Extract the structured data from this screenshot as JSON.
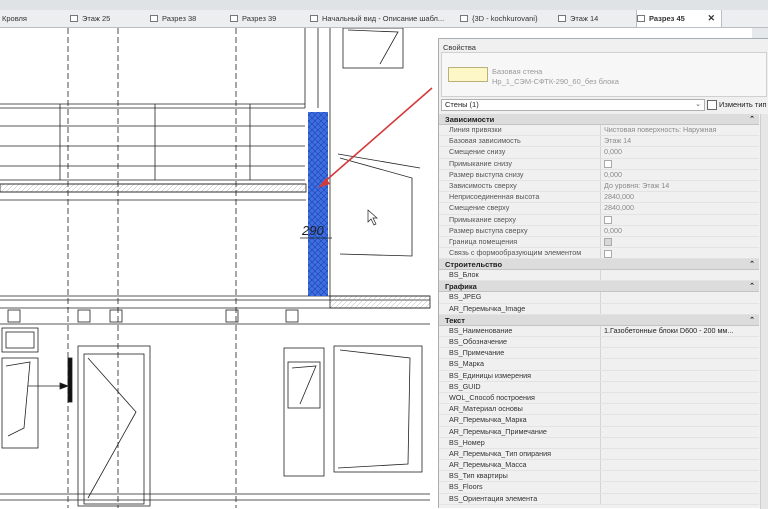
{
  "tabs": [
    {
      "label": "Кровля"
    },
    {
      "label": "Этаж 25"
    },
    {
      "label": "Разрез 38"
    },
    {
      "label": "Разрез 39"
    },
    {
      "label": "Начальный вид - Описание шабл..."
    },
    {
      "label": "{3D - kochkurovani}"
    },
    {
      "label": "Этаж 14"
    },
    {
      "label": "Разрез 45"
    }
  ],
  "active_tab_close": "✕",
  "drawing": {
    "dimension_text": "290",
    "selection_color": "#3e6fe0",
    "leader_color": "#d33a3a"
  },
  "properties": {
    "title": "Свойства",
    "type_line1": "Базовая стена",
    "type_line2": "Нр_1_СЭМ-СФТК-290_60_без блока",
    "selector": "Стены (1)",
    "edit_type": "Изменить тип",
    "sections": [
      {
        "name": "Зависимости",
        "arrow": "⌃",
        "rows": [
          {
            "name": "Линия привязки",
            "value": "Чистовая поверхность: Наружная"
          },
          {
            "name": "Базовая зависимость",
            "value": "Этаж 14"
          },
          {
            "name": "Смещение снизу",
            "value": "0,000"
          },
          {
            "name": "Примыкание снизу",
            "value": ""
          },
          {
            "name": "Размер выступа снизу",
            "value": "0,000"
          },
          {
            "name": "Зависимость сверху",
            "value": "До уровня: Этаж 14"
          },
          {
            "name": "Неприсоединенная высота",
            "value": "2840,000"
          },
          {
            "name": "Смещение сверху",
            "value": "2840,000"
          },
          {
            "name": "Примыкание сверху",
            "value": ""
          },
          {
            "name": "Размер выступа сверху",
            "value": "0,000"
          },
          {
            "name": "Граница помещения",
            "value": ""
          },
          {
            "name": "Связь с формообразующим элементом",
            "value": ""
          }
        ]
      },
      {
        "name": "Строительство",
        "arrow": "⌃",
        "rows": [
          {
            "name": "BS_Блок",
            "value": ""
          }
        ]
      },
      {
        "name": "Графика",
        "arrow": "⌃",
        "rows": [
          {
            "name": "BS_JPEG",
            "value": ""
          },
          {
            "name": "AR_Перемычка_Image",
            "value": ""
          }
        ]
      },
      {
        "name": "Текст",
        "arrow": "⌃",
        "rows": [
          {
            "name": "BS_Наименование",
            "value": "1.Газобетонные блоки D600 - 200 мм..."
          },
          {
            "name": "BS_Обозначение",
            "value": ""
          },
          {
            "name": "BS_Примечание",
            "value": ""
          },
          {
            "name": "BS_Марка",
            "value": ""
          },
          {
            "name": "BS_Единицы измерения",
            "value": ""
          },
          {
            "name": "BS_GUID",
            "value": ""
          },
          {
            "name": "WOL_Способ построения",
            "value": ""
          },
          {
            "name": "AR_Материал основы",
            "value": ""
          },
          {
            "name": "AR_Перемычка_Марка",
            "value": ""
          },
          {
            "name": "AR_Перемычка_Примечание",
            "value": ""
          },
          {
            "name": "BS_Номер",
            "value": ""
          },
          {
            "name": "AR_Перемычка_Тип опирания",
            "value": ""
          },
          {
            "name": "AR_Перемычка_Масса",
            "value": ""
          },
          {
            "name": "BS_Тип квартиры",
            "value": ""
          },
          {
            "name": "BS_Floors",
            "value": ""
          },
          {
            "name": "BS_Ориентация элемента",
            "value": ""
          }
        ]
      }
    ]
  }
}
